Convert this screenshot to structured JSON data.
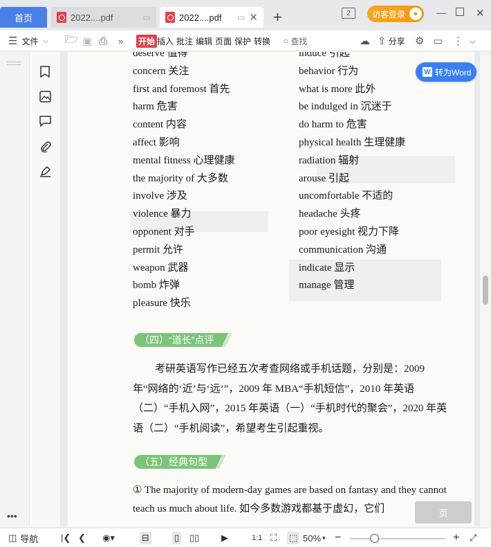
{
  "titlebar": {
    "home_tab": "首页",
    "tabs": [
      {
        "label": "2022....pdf",
        "active": false
      },
      {
        "label": "2022....pdf",
        "active": true
      }
    ],
    "badge": "2",
    "login_label": "访客登录"
  },
  "toolbar": {
    "menu_label": "文件",
    "start_label": "开始",
    "items": [
      "插入",
      "批注",
      "编辑",
      "页面",
      "保护",
      "转换"
    ],
    "search_label": "查找",
    "share_label": "分享"
  },
  "convert_button": "转为Word",
  "document": {
    "vocab_left": [
      "deserve 值得",
      "concern 关注",
      "first and foremost 首先",
      "harm 危害",
      "content 内容",
      "affect 影响",
      "mental fitness 心理健康",
      "the majority of 大多数",
      "involve 涉及",
      "violence 暴力",
      "opponent 对手",
      "permit 允许",
      "weapon 武器",
      "bomb 炸弹",
      "pleasure 快乐"
    ],
    "vocab_right": [
      "induce 引起",
      "behavior 行为",
      "what is more 此外",
      "be indulged in 沉迷于",
      "do harm to 危害",
      "physical health 生理健康",
      "radiation 辐射",
      "arouse 引起",
      "uncomfortable 不适的",
      "headache 头疼",
      "poor eyesight 视力下降",
      "communication 沟通",
      "indicate 显示",
      "manage 管理"
    ],
    "section4_title": "（四）“道长”点评",
    "section4_text": "考研英语写作已经五次考查网络或手机话题，分别是：2009 年“网络的‘近’与‘远’”，2009 年 MBA“手机短信”，2010 年英语（二）“手机入网”，2015 年英语（一）“手机时代的聚会”，2020 年英语（二）“手机阅读”，希望考生引起重视。",
    "section5_title": "（五）经典句型",
    "section5_text": "① The majority of modern-day games are based on fantasy and they cannot teach us much about life. 如今多数游戏都基于虚幻，它们"
  },
  "page_chip": "页",
  "statusbar": {
    "nav_label": "导航",
    "zoom": "50%"
  }
}
